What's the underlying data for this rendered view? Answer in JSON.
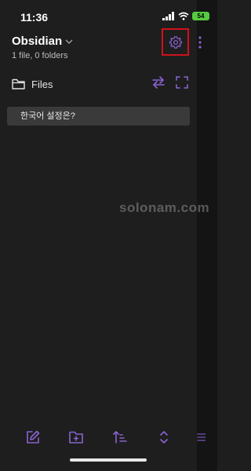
{
  "status_bar": {
    "time": "11:36",
    "battery": "54"
  },
  "vault": {
    "name": "Obsidian",
    "summary": "1 file, 0 folders"
  },
  "files_panel": {
    "title": "Files"
  },
  "files": [
    {
      "name": "한국어 설정은?"
    }
  ],
  "watermark": "solonam.com",
  "colors": {
    "accent": "#8a63d2",
    "highlight": "#d0121b",
    "background": "#1e1e1e",
    "item_bg": "#3a3a3a"
  },
  "icons": {
    "header": [
      "chevron-down-icon",
      "settings-gear-icon",
      "more-vertical-icon"
    ],
    "files_panel": [
      "folder-icon",
      "swap-icon",
      "expand-icon"
    ],
    "toolbar": [
      "new-note-icon",
      "new-folder-icon",
      "sort-icon",
      "expand-collapse-icon",
      "menu-icon"
    ]
  }
}
